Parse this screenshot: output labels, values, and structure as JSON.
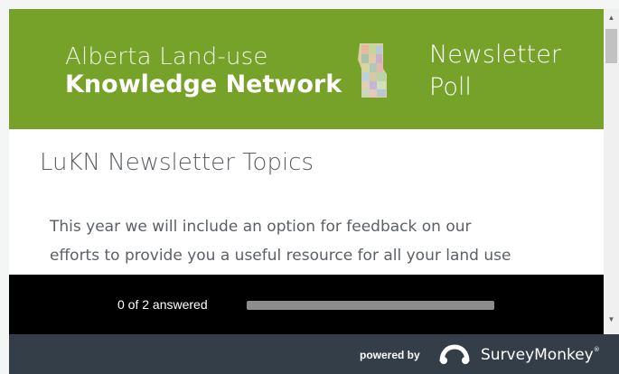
{
  "header": {
    "brand_line1": "Alberta Land-use",
    "brand_line2": "Knowledge Network",
    "poll_title_line1": "Newsletter",
    "poll_title_line2": "Poll",
    "map_icon": "alberta-map-icon",
    "background_color": "#76a22a"
  },
  "content": {
    "page_title": "LuKN Newsletter Topics",
    "intro_line1": "This year we will include an option for feedback on our",
    "intro_line2": "efforts to provide you a useful resource for all your land use"
  },
  "progress": {
    "label": "0 of 2 answered",
    "answered": 0,
    "total": 2
  },
  "footer": {
    "powered_by": "powered by",
    "brand": "SurveyMonkey",
    "logo_icon": "surveymonkey-logo-icon",
    "background_color": "#333e48"
  },
  "scrollbar": {
    "up_arrow": "▲",
    "down_arrow": "▼"
  }
}
